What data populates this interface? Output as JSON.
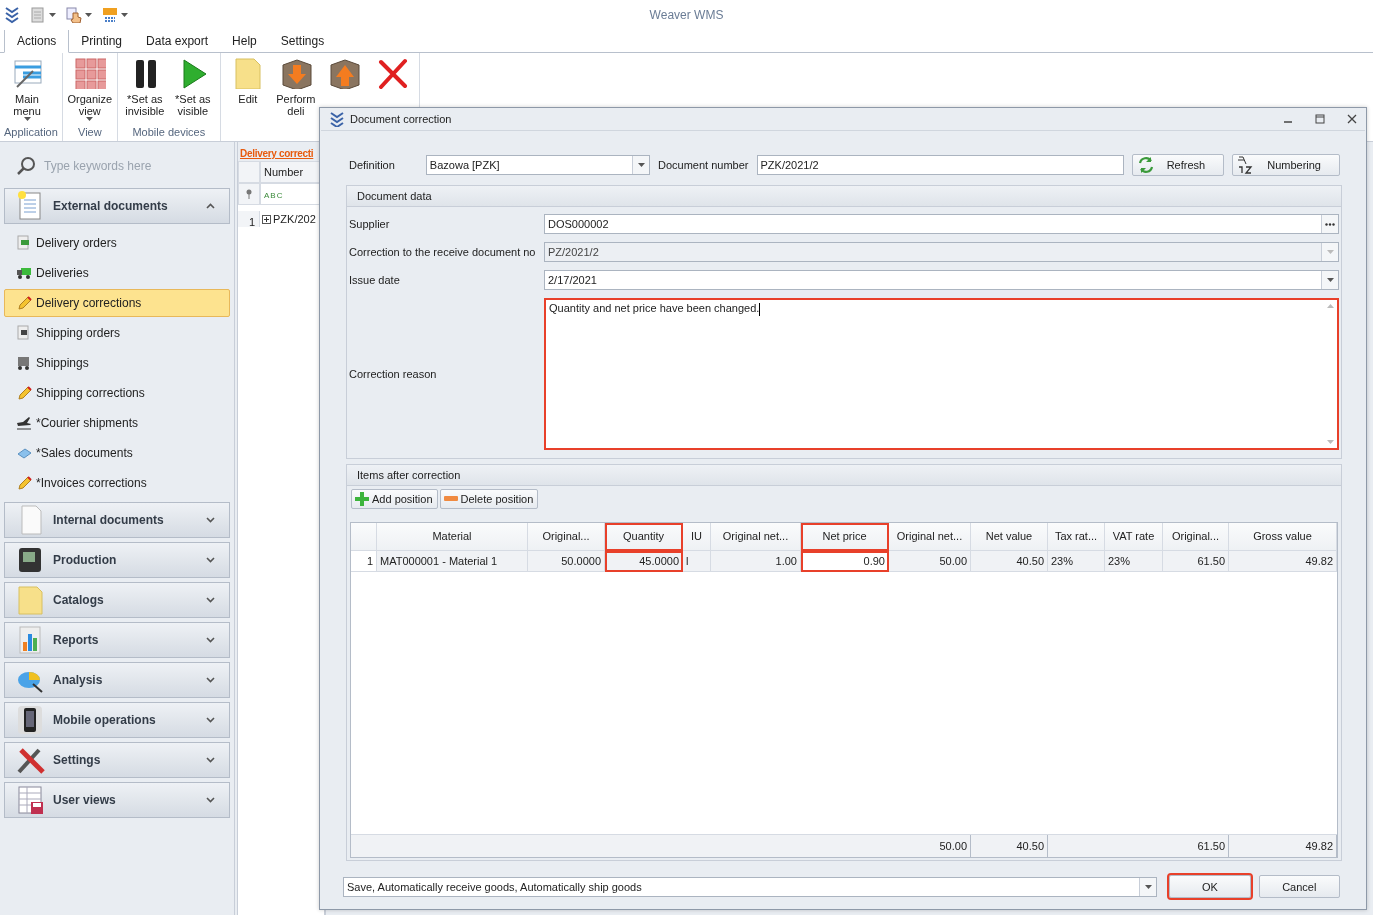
{
  "app": {
    "title": "Weaver WMS"
  },
  "ribbon_tabs": [
    {
      "label": "Actions",
      "selected": true
    },
    {
      "label": "Printing",
      "selected": false
    },
    {
      "label": "Data export",
      "selected": false
    },
    {
      "label": "Help",
      "selected": false
    },
    {
      "label": "Settings",
      "selected": false
    }
  ],
  "ribbon_groups": [
    {
      "label": "Application",
      "buttons": [
        {
          "label": "Main menu",
          "dropdown": true
        }
      ]
    },
    {
      "label": "View",
      "buttons": [
        {
          "label": "Organize view",
          "dropdown": true
        }
      ]
    },
    {
      "label": "Mobile devices",
      "buttons": [
        {
          "label": "*Set as invisible",
          "dropdown": false
        },
        {
          "label": "*Set as visible",
          "dropdown": false
        }
      ]
    },
    {
      "buttons": [
        {
          "label": "Edit",
          "dropdown": false
        },
        {
          "label": "Perform deli",
          "dropdown": false
        },
        {
          "dropdown": false
        },
        {
          "dropdown": false
        }
      ]
    }
  ],
  "sidebar": {
    "search": {
      "placeholder": "Type keywords here"
    },
    "sections": [
      {
        "label": "External documents",
        "expanded": true,
        "items": [
          {
            "label": "Delivery orders",
            "selected": false
          },
          {
            "label": "Deliveries",
            "selected": false
          },
          {
            "label": "Delivery corrections",
            "selected": true
          },
          {
            "label": "Shipping orders",
            "selected": false
          },
          {
            "label": "Shippings",
            "selected": false
          },
          {
            "label": "Shipping corrections",
            "selected": false
          },
          {
            "label": "*Courier shipments",
            "selected": false
          },
          {
            "label": "*Sales documents",
            "selected": false
          },
          {
            "label": "*Invoices corrections",
            "selected": false
          }
        ]
      },
      {
        "label": "Internal documents",
        "expanded": false
      },
      {
        "label": "Production",
        "expanded": false
      },
      {
        "label": "Catalogs",
        "expanded": false
      },
      {
        "label": "Reports",
        "expanded": false
      },
      {
        "label": "Analysis",
        "expanded": false
      },
      {
        "label": "Mobile operations",
        "expanded": false
      },
      {
        "label": "Settings",
        "expanded": false
      },
      {
        "label": "User views",
        "expanded": false
      }
    ]
  },
  "list_panel": {
    "title": "Delivery correcti",
    "column": "Number",
    "filter": "ABC",
    "rows": [
      {
        "number": "1",
        "value": "PZK/202"
      }
    ]
  },
  "dialog": {
    "title": "Document correction",
    "definition": {
      "label": "Definition",
      "value": "Bazowa [PZK]"
    },
    "document_number": {
      "label": "Document number",
      "value": "PZK/2021/2"
    },
    "header_buttons": [
      {
        "label": "Refresh"
      },
      {
        "label": "Numbering"
      }
    ],
    "document_data": {
      "title": "Document data",
      "fields": [
        {
          "label": "Supplier",
          "value": "DOS000002",
          "kind": "lookup",
          "disabled": false,
          "highlighted": false
        },
        {
          "label": "Correction to the receive document no",
          "value": "PZ/2021/2",
          "kind": "combo",
          "disabled": true,
          "highlighted": false
        },
        {
          "label": "Issue date",
          "value": "2/17/2021",
          "kind": "combo",
          "disabled": false,
          "highlighted": false
        },
        {
          "label": "Correction reason",
          "value": "Quantity and net price have been changed.",
          "kind": "memo",
          "disabled": false,
          "highlighted": true
        }
      ]
    },
    "items": {
      "title": "Items after correction",
      "toolbar": [
        {
          "label": "Add position"
        },
        {
          "label": "Delete position"
        }
      ],
      "columns": [
        {
          "label": "Material",
          "numeric": false,
          "highlighted": false
        },
        {
          "label": "Original...",
          "numeric": true,
          "highlighted": false
        },
        {
          "label": "Quantity",
          "numeric": true,
          "highlighted": true
        },
        {
          "label": "IU",
          "numeric": false,
          "highlighted": false
        },
        {
          "label": "Original net...",
          "numeric": true,
          "highlighted": false
        },
        {
          "label": "Net price",
          "numeric": true,
          "highlighted": true
        },
        {
          "label": "Original net...",
          "numeric": true,
          "highlighted": false,
          "total": "50.00"
        },
        {
          "label": "Net value",
          "numeric": true,
          "highlighted": false,
          "total": "40.50"
        },
        {
          "label": "Tax rat...",
          "numeric": false,
          "highlighted": false
        },
        {
          "label": "VAT rate",
          "numeric": false,
          "highlighted": false
        },
        {
          "label": "Original...",
          "numeric": true,
          "highlighted": false,
          "total": "61.50"
        },
        {
          "label": "Gross value",
          "numeric": true,
          "highlighted": false,
          "total": "49.82"
        }
      ],
      "rows": [
        {
          "number": "1",
          "cells": [
            "MAT000001 - Material 1",
            "50.0000",
            "45.0000",
            "l",
            "1.00",
            "0.90",
            "50.00",
            "40.50",
            "23%",
            "23%",
            "61.50",
            "49.82"
          ]
        }
      ]
    },
    "action": {
      "value": "Save, Automatically receive goods, Automatically ship goods"
    },
    "buttons": [
      {
        "label": "OK",
        "highlighted": true
      },
      {
        "label": "Cancel",
        "highlighted": false
      }
    ]
  }
}
